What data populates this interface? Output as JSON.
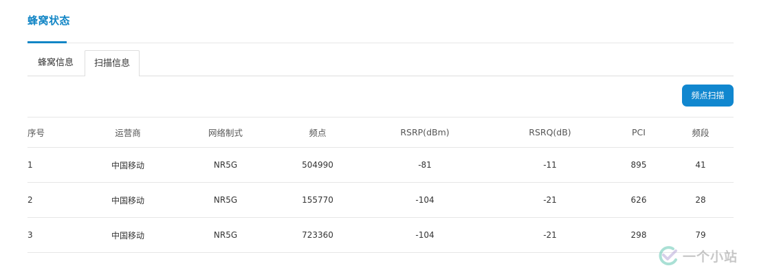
{
  "page": {
    "title": "蜂窝状态"
  },
  "tabs": [
    {
      "label": "蜂窝信息",
      "active": false
    },
    {
      "label": "扫描信息",
      "active": true
    }
  ],
  "toolbar": {
    "scan_button_label": "频点扫描"
  },
  "table": {
    "headers": [
      "序号",
      "运营商",
      "网络制式",
      "频点",
      "RSRP(dBm)",
      "RSRQ(dB)",
      "PCI",
      "频段"
    ],
    "rows": [
      [
        "1",
        "中国移动",
        "NR5G",
        "504990",
        "-81",
        "-11",
        "895",
        "41"
      ],
      [
        "2",
        "中国移动",
        "NR5G",
        "155770",
        "-104",
        "-21",
        "626",
        "28"
      ],
      [
        "3",
        "中国移动",
        "NR5G",
        "723360",
        "-104",
        "-21",
        "298",
        "79"
      ]
    ]
  },
  "watermark": {
    "text": "一个小站"
  },
  "colors": {
    "accent": "#1185c5",
    "button": "#1187cf",
    "divider": "#e6e6e6"
  }
}
